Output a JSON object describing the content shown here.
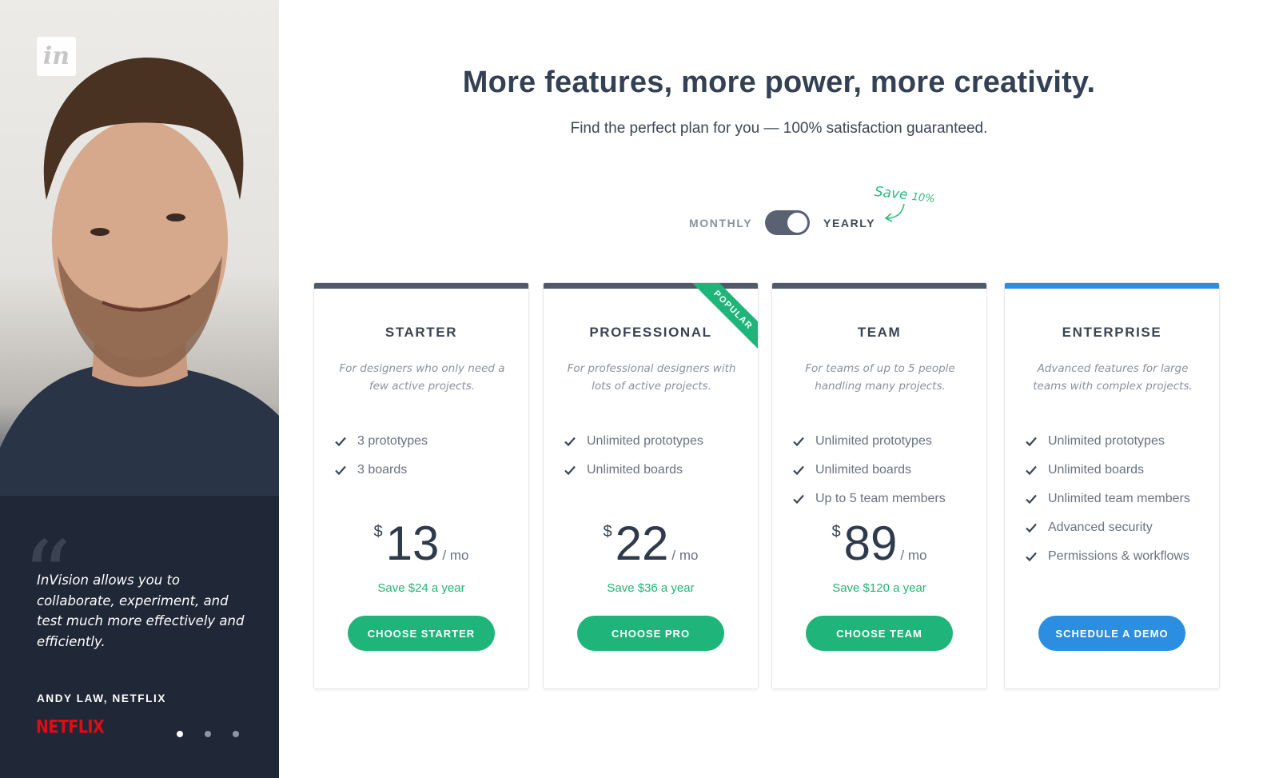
{
  "brand": {
    "logo_text": "in"
  },
  "testimonial": {
    "quote": "InVision allows you to collaborate, experiment, and test much more effectively and efficiently.",
    "author": "ANDY LAW, NETFLIX",
    "company_logo": "NETFLIX",
    "slides": 3,
    "active_slide": 1
  },
  "header": {
    "title": "More features, more power, more creativity.",
    "subtitle": "Find the perfect plan for you — 100% satisfaction guaranteed."
  },
  "billing_toggle": {
    "monthly_label": "MONTHLY",
    "yearly_label": "YEARLY",
    "selected": "yearly",
    "save_note": "Save",
    "save_pct": "10%"
  },
  "colors": {
    "green": "#1fb57a",
    "blue": "#2b8ee0",
    "dark": "#505a68",
    "netflix_red": "#e50914"
  },
  "plans": [
    {
      "name": "STARTER",
      "description": "For designers who only need a few active projects.",
      "features": [
        "3 prototypes",
        "3 boards"
      ],
      "currency": "$",
      "price": "13",
      "period": "/ mo",
      "saving": "Save $24 a year",
      "cta": "CHOOSE STARTER"
    },
    {
      "name": "PROFESSIONAL",
      "badge": "POPULAR",
      "description": "For professional designers with lots of active projects.",
      "features": [
        "Unlimited prototypes",
        "Unlimited boards"
      ],
      "currency": "$",
      "price": "22",
      "period": "/ mo",
      "saving": "Save $36 a year",
      "cta": "CHOOSE PRO"
    },
    {
      "name": "TEAM",
      "description": "For teams of up to 5 people handling many projects.",
      "features": [
        "Unlimited prototypes",
        "Unlimited boards",
        "Up to 5 team members"
      ],
      "currency": "$",
      "price": "89",
      "period": "/ mo",
      "saving": "Save $120 a year",
      "cta": "CHOOSE TEAM"
    },
    {
      "name": "ENTERPRISE",
      "description": "Advanced features for large teams with complex projects.",
      "features": [
        "Unlimited prototypes",
        "Unlimited boards",
        "Unlimited team members",
        "Advanced security",
        "Permissions & workflows"
      ],
      "cta": "SCHEDULE A DEMO"
    }
  ]
}
